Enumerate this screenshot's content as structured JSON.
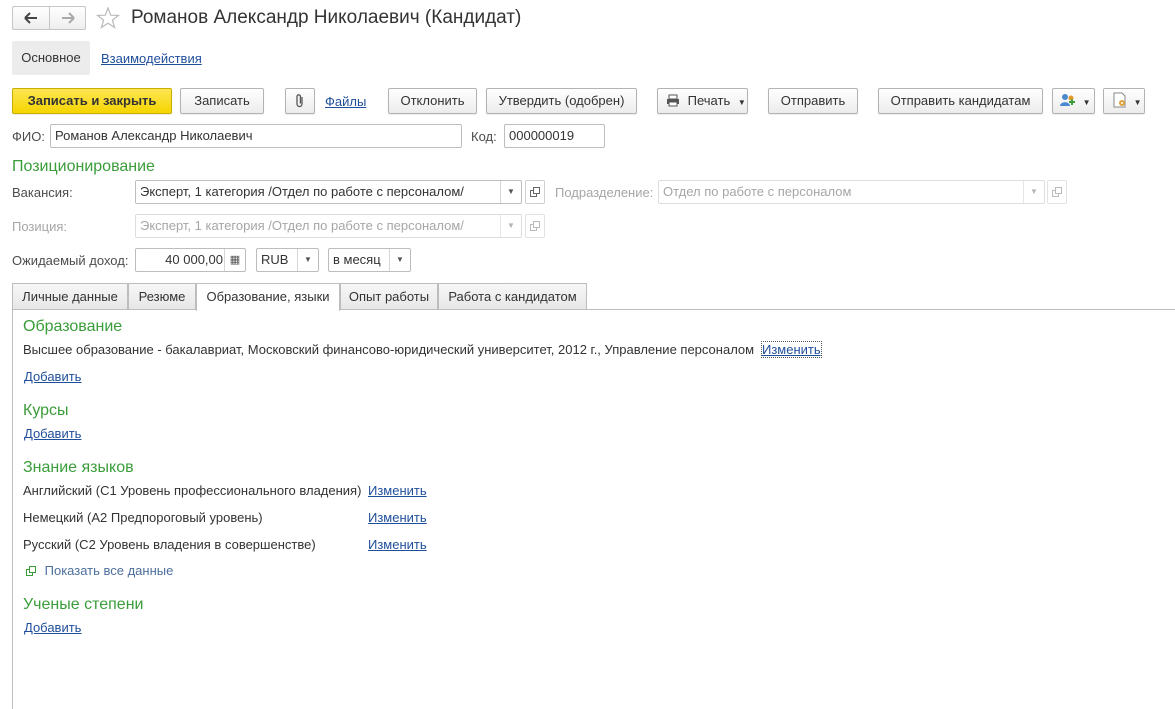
{
  "window": {
    "title": "Романов Александр Николаевич (Кандидат)"
  },
  "nav_tabs": {
    "main": "Основное",
    "interactions": "Взаимодействия"
  },
  "toolbar": {
    "save_close": "Записать и закрыть",
    "save": "Записать",
    "files": "Файлы",
    "reject": "Отклонить",
    "approve": "Утвердить (одобрен)",
    "print": "Печать",
    "send": "Отправить",
    "send_candidates": "Отправить кандидатам"
  },
  "form": {
    "fio_label": "ФИО:",
    "fio_value": "Романов Александр Николаевич",
    "code_label": "Код:",
    "code_value": "000000019",
    "positioning_title": "Позиционирование",
    "vacancy_label": "Вакансия:",
    "vacancy_value": "Эксперт, 1 категория /Отдел по работе с персоналом/",
    "department_label": "Подразделение:",
    "department_value": "Отдел по работе с персоналом",
    "position_label": "Позиция:",
    "position_value": "Эксперт, 1 категория /Отдел по работе с персоналом/",
    "income_label": "Ожидаемый доход:",
    "income_value": "40 000,00",
    "currency_value": "RUB",
    "period_value": "в месяц"
  },
  "tabs": [
    {
      "label": "Личные данные"
    },
    {
      "label": "Резюме"
    },
    {
      "label": "Образование, языки"
    },
    {
      "label": "Опыт работы"
    },
    {
      "label": "Работа с кандидатом"
    }
  ],
  "education": {
    "title": "Образование",
    "entry": "Высшее образование - бакалавриат, Московский финансово-юридический университет, 2012 г., Управление персоналом",
    "change_link": "Изменить",
    "add_link": "Добавить"
  },
  "courses": {
    "title": "Курсы",
    "add_link": "Добавить"
  },
  "languages": {
    "title": "Знание языков",
    "items": [
      {
        "text": "Английский (С1 Уровень профессионального владения)",
        "link": "Изменить"
      },
      {
        "text": "Немецкий (А2 Предпороговый уровень)",
        "link": "Изменить"
      },
      {
        "text": "Русский (С2 Уровень владения в совершенстве)",
        "link": "Изменить"
      }
    ],
    "show_all": "Показать все данные"
  },
  "degrees": {
    "title": "Ученые степени",
    "add_link": "Добавить"
  },
  "colors": {
    "section_green": "#3a9d3a",
    "primary_yellow": "#f5d500",
    "link_blue": "#1f4e9b"
  }
}
